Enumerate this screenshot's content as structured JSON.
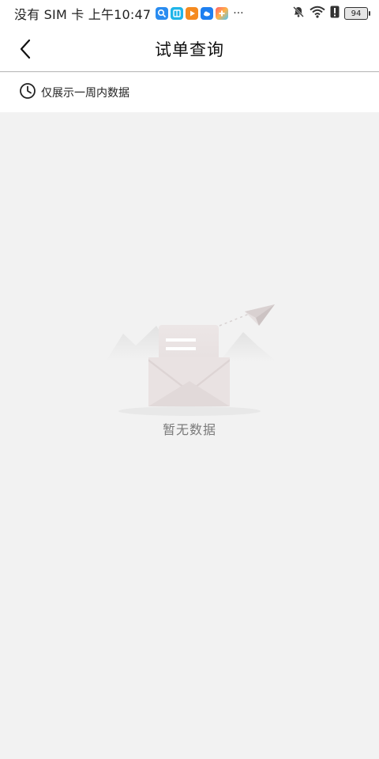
{
  "status_bar": {
    "carrier_time": "没有 SIM 卡 上午10:47",
    "more": "···",
    "battery": "94"
  },
  "header": {
    "title": "试单查询"
  },
  "info": {
    "notice": "仅展示一周内数据"
  },
  "empty": {
    "message": "暂无数据"
  },
  "colors": {
    "header_bg": "#ffffff",
    "page_bg": "#f2f2f2",
    "empty_text": "#7a7a7a"
  }
}
